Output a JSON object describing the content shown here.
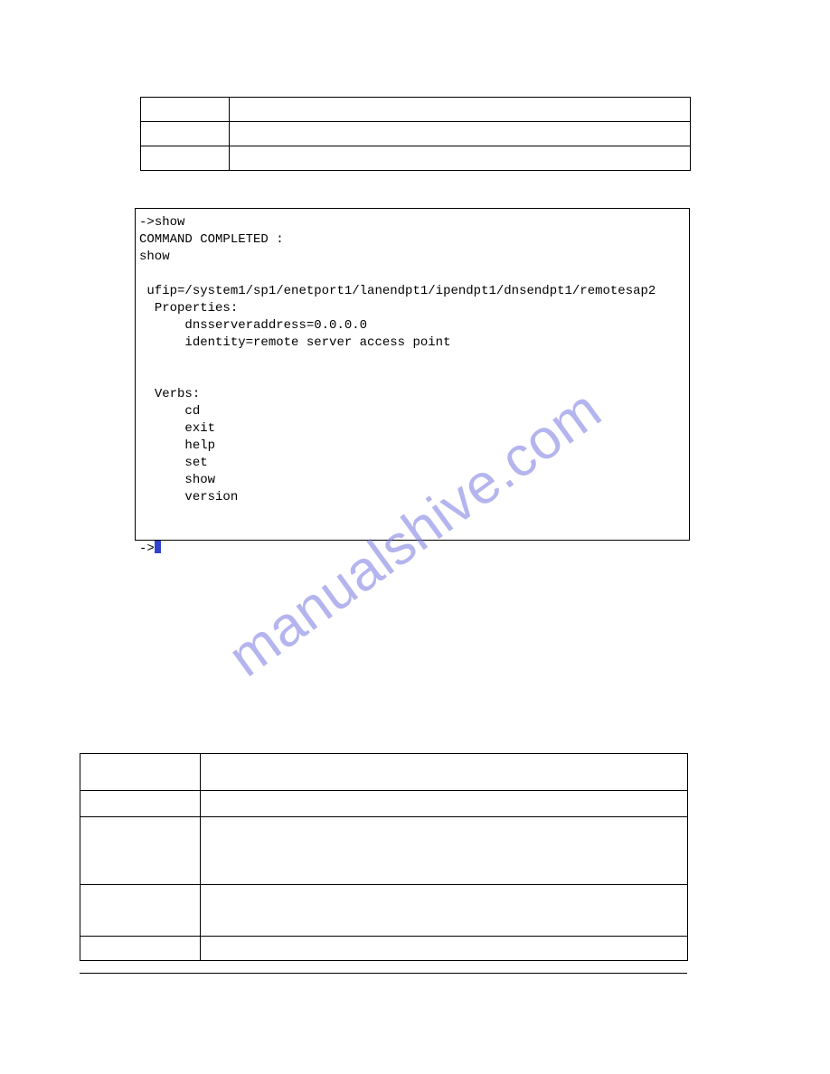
{
  "watermark": "manualshive.com",
  "terminal": {
    "prompt": "->",
    "cmd": "show",
    "completed": "COMMAND COMPLETED :",
    "echo": "show",
    "ufip_label": "ufip=",
    "ufip_path": "/system1/sp1/enetport1/lanendpt1/ipendpt1/dnsendpt1/remotesap2",
    "properties_label": "Properties:",
    "props": [
      "dnsserveraddress=0.0.0.0",
      "identity=remote server access point"
    ],
    "verbs_label": "Verbs:",
    "verbs": [
      "cd",
      "exit",
      "help",
      "set",
      "show",
      "version"
    ]
  },
  "top_table": {
    "rows": [
      {
        "c1": "",
        "c2": ""
      },
      {
        "c1": "",
        "c2": ""
      },
      {
        "c1": "",
        "c2": ""
      }
    ]
  },
  "bottom_table": {
    "rows": [
      {
        "c1": "",
        "c2": ""
      },
      {
        "c1": "",
        "c2": ""
      },
      {
        "c1": "",
        "c2": ""
      },
      {
        "c1": "",
        "c2": ""
      },
      {
        "c1": "",
        "c2": ""
      }
    ]
  }
}
